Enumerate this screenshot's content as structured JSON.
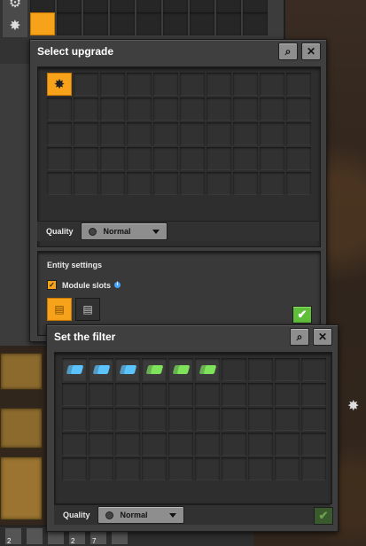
{
  "upgrade_window": {
    "title": "Select upgrade",
    "quality_label": "Quality",
    "quality_value": "Normal"
  },
  "entity_settings": {
    "title": "Entity settings",
    "module_slots_label": "Module slots",
    "info_icon": "i"
  },
  "filter_window": {
    "title": "Set the filter",
    "quality_label": "Quality",
    "quality_value": "Normal"
  },
  "icons": {
    "search": "⌕",
    "close": "✕",
    "check": "✔",
    "turret": "✸"
  },
  "hotbar": {
    "counts": [
      "2",
      "2",
      "7"
    ]
  },
  "colors": {
    "accent_orange": "#f7a21b",
    "confirm_green": "#5fbf3a",
    "ammo_blue": "#5bc4ff",
    "ammo_green": "#7ee35a"
  }
}
